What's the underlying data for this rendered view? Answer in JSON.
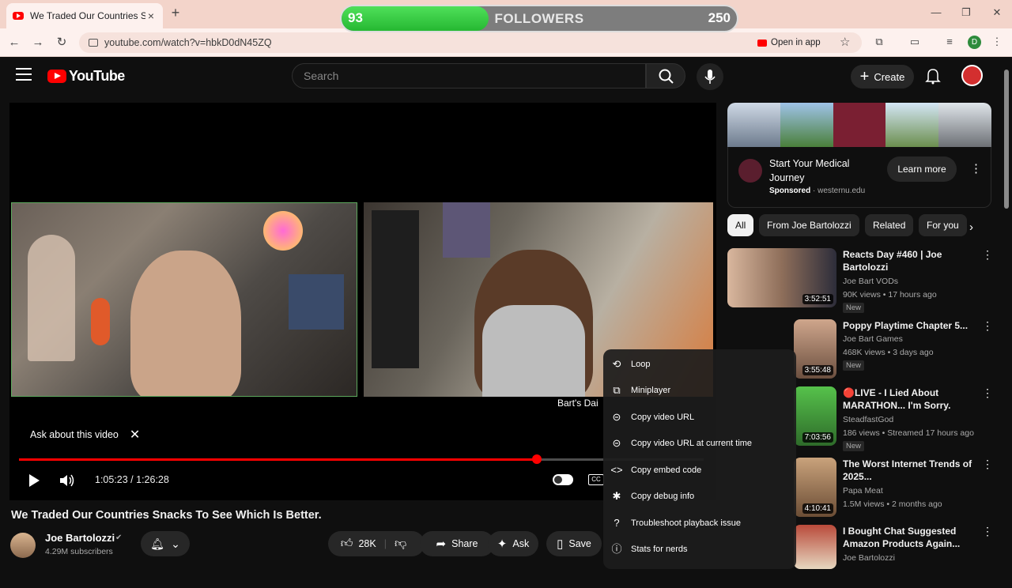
{
  "browser": {
    "tab_title": "We Traded Our Countries Snack",
    "url": "youtube.com/watch?v=hbkD0dN45ZQ",
    "open_in_app": "Open in app",
    "profile_letter": "D"
  },
  "overlay": {
    "current": "93",
    "label": "FOLLOWERS",
    "goal": "250",
    "progress_fraction": 0.372
  },
  "header": {
    "logo_text": "YouTube",
    "search_placeholder": "Search",
    "create_label": "Create"
  },
  "player": {
    "ask_label": "Ask about this video",
    "chat_name": "Bart's Dai",
    "time": "1:05:23 / 1:26:28",
    "progress_fraction": 0.756
  },
  "context_menu": {
    "items": [
      {
        "label": "Loop",
        "icon": "loop-icon"
      },
      {
        "label": "Miniplayer",
        "icon": "miniplayer-icon"
      },
      {
        "label": "Copy video URL",
        "icon": "link-icon"
      },
      {
        "label": "Copy video URL at current time",
        "icon": "link-icon"
      },
      {
        "label": "Copy embed code",
        "icon": "code-icon"
      },
      {
        "label": "Copy debug info",
        "icon": "bug-icon"
      },
      {
        "label": "Troubleshoot playback issue",
        "icon": "help-icon"
      },
      {
        "label": "Stats for nerds",
        "icon": "info-icon"
      }
    ]
  },
  "video": {
    "title": "We Traded Our Countries Snacks To See Which Is Better.",
    "channel": "Joe Bartolozzi",
    "subscribers": "4.29M subscribers",
    "likes": "28K",
    "share": "Share",
    "ask": "Ask",
    "save": "Save"
  },
  "ad": {
    "title": "Start Your Medical Journey",
    "sponsored": "Sponsored",
    "domain": "westernu.edu",
    "cta": "Learn more"
  },
  "chips": [
    "All",
    "From Joe Bartolozzi",
    "Related",
    "For you"
  ],
  "recommendations": [
    {
      "title": "Reacts Day #460 | Joe Bartolozzi",
      "channel": "Joe Bart VODs",
      "meta": "90K views • 17 hours ago",
      "badge": "New",
      "duration": "3:52:51"
    },
    {
      "title": "Poppy Playtime Chapter 5...",
      "channel": "Joe Bart Games",
      "meta": "468K views • 3 days ago",
      "badge": "New",
      "duration": "3:55:48"
    },
    {
      "title": "🔴LIVE - I Lied About MARATHON... I'm Sorry.",
      "channel": "SteadfastGod",
      "meta": "186 views • Streamed 17 hours ago",
      "badge": "New",
      "duration": "7:03:56"
    },
    {
      "title": "The Worst Internet Trends of 2025...",
      "channel": "Papa Meat",
      "meta": "1.5M views • 2 months ago",
      "badge": "",
      "duration": "4:10:41"
    },
    {
      "title": "I Bought Chat Suggested Amazon Products Again...",
      "channel": "Joe Bartolozzi",
      "meta": "",
      "badge": "",
      "duration": ""
    }
  ]
}
